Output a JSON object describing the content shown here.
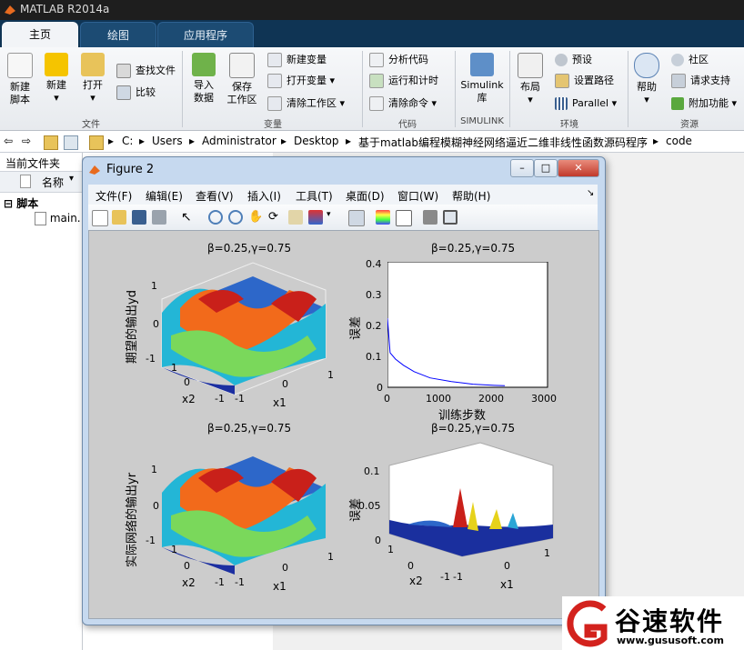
{
  "app": {
    "title": "MATLAB R2014a"
  },
  "tabs": [
    {
      "label": "主页"
    },
    {
      "label": "绘图"
    },
    {
      "label": "应用程序"
    }
  ],
  "ribbon": {
    "file": {
      "new_script": "新建\n脚本",
      "new": "新建",
      "open": "打开",
      "find_files": "查找文件",
      "compare": "比较",
      "group": "文件"
    },
    "variable": {
      "import": "导入\n数据",
      "save": "保存\n工作区",
      "new_var": "新建变量",
      "open_var": "打开变量",
      "clear_ws": "清除工作区",
      "group": "变量"
    },
    "code": {
      "analyze": "分析代码",
      "run_time": "运行和计时",
      "clear_cmd": "清除命令",
      "group": "代码"
    },
    "simulink": {
      "label": "Simulink\n库",
      "group": "SIMULINK"
    },
    "env": {
      "layout": "布局",
      "prefs": "预设",
      "set_path": "设置路径",
      "parallel": "Parallel",
      "group": "环境"
    },
    "resources": {
      "help": "帮助",
      "community": "社区",
      "request": "请求支持",
      "addons": "附加功能",
      "group": "资源"
    }
  },
  "address": {
    "items": [
      "C:",
      "Users",
      "Administrator",
      "Desktop",
      "基于matlab编程模糊神经网络逼近二维非线性函数源码程序",
      "code"
    ]
  },
  "left_panel": {
    "title": "当前文件夹",
    "column": "名称",
    "group": "脚本",
    "file": "main."
  },
  "figure": {
    "title": "Figure 2",
    "menus": [
      "文件(F)",
      "编辑(E)",
      "查看(V)",
      "插入(I)",
      "工具(T)",
      "桌面(D)",
      "窗口(W)",
      "帮助(H)"
    ],
    "plots": {
      "p1": {
        "title": "β=0.25,γ=0.75",
        "zlabel": "期望的输出yd",
        "xlabel": "x1",
        "ylabel": "x2"
      },
      "p2": {
        "title": "β=0.25,γ=0.75",
        "ylabel": "误差",
        "xlabel": "训练步数"
      },
      "p3": {
        "title": "β=0.25,γ=0.75",
        "zlabel": "实际网络的输出yr",
        "xlabel": "x1",
        "ylabel": "x2"
      },
      "p4": {
        "title": "β=0.25,γ=0.75",
        "zlabel": "误差",
        "xlabel": "x1",
        "ylabel": "x2"
      }
    },
    "ticks3d": {
      "z": [
        "1",
        "0",
        "-1"
      ],
      "x": [
        "-1",
        "0",
        "1"
      ],
      "y": [
        "1",
        "0",
        "-1"
      ]
    },
    "ticks_p2": {
      "y": [
        "0.4",
        "0.3",
        "0.2",
        "0.1",
        "0"
      ],
      "x": [
        "0",
        "1000",
        "2000",
        "3000"
      ]
    },
    "ticks_p4": {
      "z": [
        "0.1",
        "0.05",
        "0"
      ]
    }
  },
  "chart_data": {
    "type": "line",
    "title": "β=0.25,γ=0.75",
    "xlabel": "训练步数",
    "ylabel": "误差",
    "xlim": [
      0,
      3000
    ],
    "ylim": [
      0,
      0.4
    ],
    "x": [
      0,
      50,
      150,
      300,
      500,
      800,
      1200,
      1600,
      2000,
      2200
    ],
    "series": [
      {
        "values": [
          0.22,
          0.11,
          0.09,
          0.07,
          0.05,
          0.03,
          0.018,
          0.01,
          0.006,
          0.005
        ]
      }
    ]
  },
  "watermark": {
    "brand": "谷速软件",
    "url": "www.gususoft.com"
  },
  "colors": {
    "tabbar": "#0f3454",
    "figure_bg": "#cccccc",
    "line": "#0000ff"
  }
}
